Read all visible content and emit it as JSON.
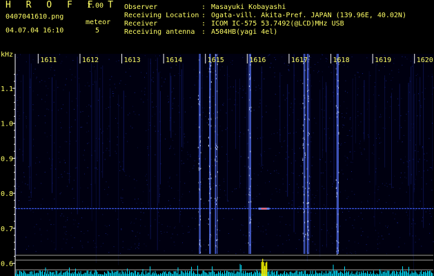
{
  "header": {
    "app_title": "H R O F F T",
    "app_version": "1.00",
    "file_name": "0407041610.png",
    "datetime": "04.07.04 16:10",
    "meteor_label": "meteor",
    "meteor_count": "5"
  },
  "info": [
    {
      "label": "Observer",
      "value": "Masayuki Kobayashi"
    },
    {
      "label": "Receiving Location",
      "value": "Ogata-vill. Akita-Pref. JAPAN (139.96E, 40.02N)"
    },
    {
      "label": "Receiver",
      "value": "ICOM IC-575 53.7492(@LCD)MHz USB"
    },
    {
      "label": "Receiving antenna",
      "value": "A504HB(yagi 4el)"
    }
  ],
  "chart_data": {
    "type": "heatmap",
    "xlabel": "",
    "ylabel": "kHz",
    "x_ticks": [
      "1611",
      "1612",
      "1613",
      "1614",
      "1615",
      "1616",
      "1617",
      "1618",
      "1619",
      "1620"
    ],
    "y_ticks": [
      "1.1",
      "1.0",
      "0.9",
      "0.8",
      "0.7",
      "0.6"
    ],
    "y_range_khz": [
      0.6,
      1.15
    ],
    "carrier_line_khz": 0.756,
    "meteor_echo": {
      "time_min": 1616.4,
      "freq_khz": 0.756
    },
    "strong_vertical_bands_min": [
      1614.85,
      1615.1,
      1615.25,
      1616.05,
      1617.35,
      1617.45,
      1618.15
    ],
    "colors": {
      "background": "#000010",
      "noise": "#1a2aa8",
      "text": "#ffff66",
      "carrier": "#4060ff",
      "spectrum": "#00e0ff",
      "peak": "#ffff00"
    }
  }
}
